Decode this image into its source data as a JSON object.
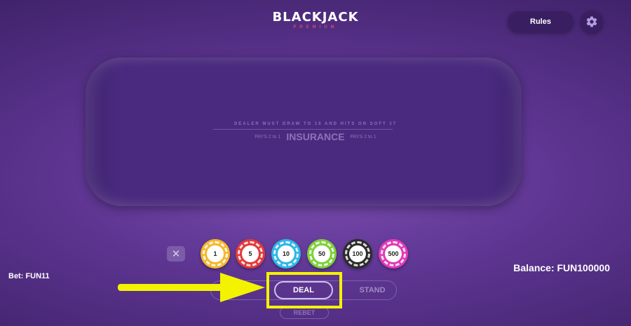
{
  "header": {
    "logo_title": "BLACKJACK",
    "logo_subtitle": "PREMIUM",
    "rules_label": "Rules",
    "settings_icon": "gear-icon"
  },
  "table": {
    "rule_text": "DEALER MUST DRAW TO 16 AND HITS ON SOFT 17",
    "insurance_label": "INSURANCE",
    "pays_left": "PAYS 2 to 1",
    "pays_right": "PAYS 2 to 1"
  },
  "chips": [
    {
      "value": "1",
      "color": "#f5b82e"
    },
    {
      "value": "5",
      "color": "#e23a3a"
    },
    {
      "value": "10",
      "color": "#2fb6e8"
    },
    {
      "value": "50",
      "color": "#7dd13a"
    },
    {
      "value": "100",
      "color": "#2b2b2b"
    },
    {
      "value": "500",
      "color": "#e23ab8"
    }
  ],
  "clear_icon": "close-icon",
  "bet": {
    "label": "Bet: FUN11"
  },
  "balance": {
    "label": "Balance: FUN100000"
  },
  "actions": {
    "deal_label": "DEAL",
    "stand_label": "STAND",
    "rebet_label": "REBET"
  },
  "annotation": {
    "highlight_color": "#f3f300",
    "arrow_icon": "arrow-right-icon"
  }
}
